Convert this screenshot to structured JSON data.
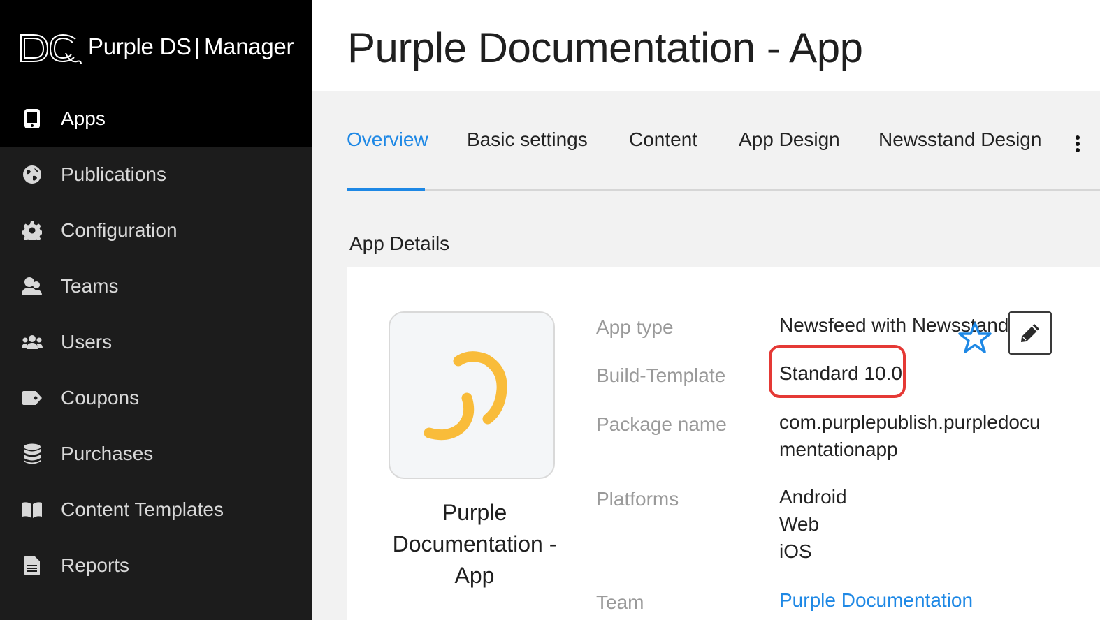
{
  "brand": {
    "name_light": "Purple DS",
    "separator": "|",
    "name_bold": "Manager"
  },
  "sidebar": {
    "items": [
      {
        "label": "Apps",
        "icon": "tablet-icon",
        "active": true
      },
      {
        "label": "Publications",
        "icon": "globe-icon",
        "active": false
      },
      {
        "label": "Configuration",
        "icon": "gear-icon",
        "active": false
      },
      {
        "label": "Teams",
        "icon": "team-icon",
        "active": false
      },
      {
        "label": "Users",
        "icon": "users-icon",
        "active": false
      },
      {
        "label": "Coupons",
        "icon": "tag-icon",
        "active": false
      },
      {
        "label": "Purchases",
        "icon": "database-icon",
        "active": false
      },
      {
        "label": "Content Templates",
        "icon": "book-icon",
        "active": false
      },
      {
        "label": "Reports",
        "icon": "document-icon",
        "active": false
      }
    ]
  },
  "header": {
    "title": "Purple Documentation - App"
  },
  "tabs": [
    {
      "label": "Overview",
      "active": true
    },
    {
      "label": "Basic settings",
      "active": false
    },
    {
      "label": "Content",
      "active": false
    },
    {
      "label": "App Design",
      "active": false
    },
    {
      "label": "Newsstand Design",
      "active": false
    }
  ],
  "section": {
    "title": "App Details"
  },
  "app": {
    "name": "Purple Documentation - App",
    "details": {
      "app_type_label": "App type",
      "app_type_value": "Newsfeed with Newsstand",
      "build_template_label": "Build-Template",
      "build_template_value": "Standard 10.0",
      "package_label": "Package name",
      "package_value_line1": "com.purplepublish.purpledocu",
      "package_value_line2": "mentationapp",
      "platforms_label": "Platforms",
      "platforms": [
        "Android",
        "Web",
        "iOS"
      ],
      "team_label": "Team",
      "team_value": "Purple Documentation"
    }
  },
  "colors": {
    "accent": "#1e88e5",
    "highlight": "#e53935",
    "logo": "#f9bc3a",
    "sidebar_bg": "#1c1c1c"
  }
}
